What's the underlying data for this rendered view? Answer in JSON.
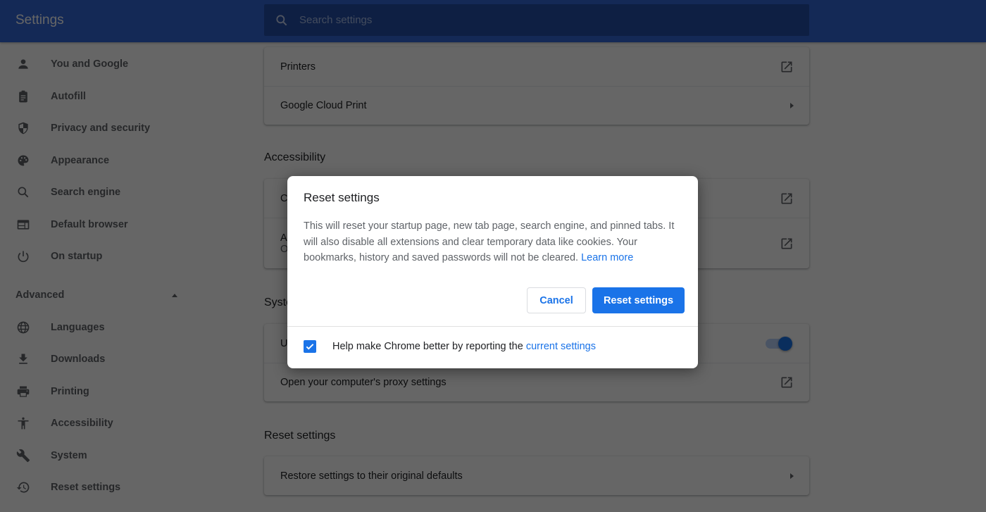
{
  "app": {
    "title": "Settings"
  },
  "search": {
    "placeholder": "Search settings",
    "icon": "search-icon"
  },
  "sidebar": {
    "items": [
      {
        "label": "You and Google",
        "icon": "person-icon"
      },
      {
        "label": "Autofill",
        "icon": "clipboard-icon"
      },
      {
        "label": "Privacy and security",
        "icon": "shield-icon"
      },
      {
        "label": "Appearance",
        "icon": "palette-icon"
      },
      {
        "label": "Search engine",
        "icon": "search-icon"
      },
      {
        "label": "Default browser",
        "icon": "browser-window-icon"
      },
      {
        "label": "On startup",
        "icon": "power-icon"
      }
    ],
    "advanced_label": "Advanced",
    "advanced_expanded": true,
    "advanced_items": [
      {
        "label": "Languages",
        "icon": "globe-icon"
      },
      {
        "label": "Downloads",
        "icon": "download-icon"
      },
      {
        "label": "Printing",
        "icon": "printer-icon"
      },
      {
        "label": "Accessibility",
        "icon": "accessibility-icon"
      },
      {
        "label": "System",
        "icon": "wrench-icon"
      },
      {
        "label": "Reset settings",
        "icon": "history-icon"
      }
    ]
  },
  "main": {
    "printing_rows": [
      {
        "label": "Printers",
        "action": "external-link"
      },
      {
        "label": "Google Cloud Print",
        "action": "arrow"
      }
    ],
    "accessibility": {
      "title": "Accessibility",
      "rows": [
        {
          "label": "C",
          "action": "external-link"
        },
        {
          "label": "A",
          "sublabel": "O",
          "action": "external-link"
        }
      ]
    },
    "system": {
      "title": "Syste",
      "rows": [
        {
          "label": "U",
          "action": "toggle",
          "toggle_on": true
        },
        {
          "label": "Open your computer's proxy settings",
          "action": "external-link"
        }
      ]
    },
    "reset": {
      "title": "Reset settings",
      "rows": [
        {
          "label": "Restore settings to their original defaults",
          "action": "arrow"
        }
      ]
    }
  },
  "dialog": {
    "title": "Reset settings",
    "body": "This will reset your startup page, new tab page, search engine, and pinned tabs. It will also disable all extensions and clear temporary data like cookies. Your bookmarks, history and saved passwords will not be cleared.",
    "learn_more": "Learn more",
    "cancel_label": "Cancel",
    "confirm_label": "Reset settings",
    "footer_text": "Help make Chrome better by reporting the",
    "footer_link": "current settings",
    "footer_checked": true
  },
  "colors": {
    "brand_blue": "#3367d6",
    "accent": "#1a73e8",
    "icon_gray": "#5f6368"
  }
}
